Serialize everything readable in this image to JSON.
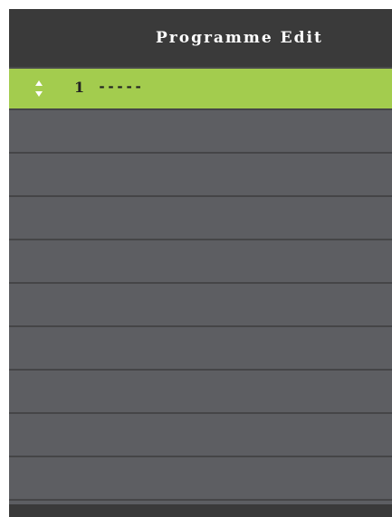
{
  "header": {
    "title": "Programme Edit"
  },
  "programmes": [
    {
      "number": "1",
      "name": "-----",
      "selected": true
    },
    {
      "number": "",
      "name": "",
      "selected": false
    },
    {
      "number": "",
      "name": "",
      "selected": false
    },
    {
      "number": "",
      "name": "",
      "selected": false
    },
    {
      "number": "",
      "name": "",
      "selected": false
    },
    {
      "number": "",
      "name": "",
      "selected": false
    },
    {
      "number": "",
      "name": "",
      "selected": false
    },
    {
      "number": "",
      "name": "",
      "selected": false
    },
    {
      "number": "",
      "name": "",
      "selected": false
    },
    {
      "number": "",
      "name": "",
      "selected": false
    }
  ],
  "icons": {
    "selected_row_icon": "up-down-arrows-icon"
  },
  "colors": {
    "header_bg": "#3a3a3a",
    "row_bg": "#5d5e62",
    "selected_row_bg": "#a3cc4e",
    "row_divider": "#454547",
    "title_text": "#ffffff"
  }
}
